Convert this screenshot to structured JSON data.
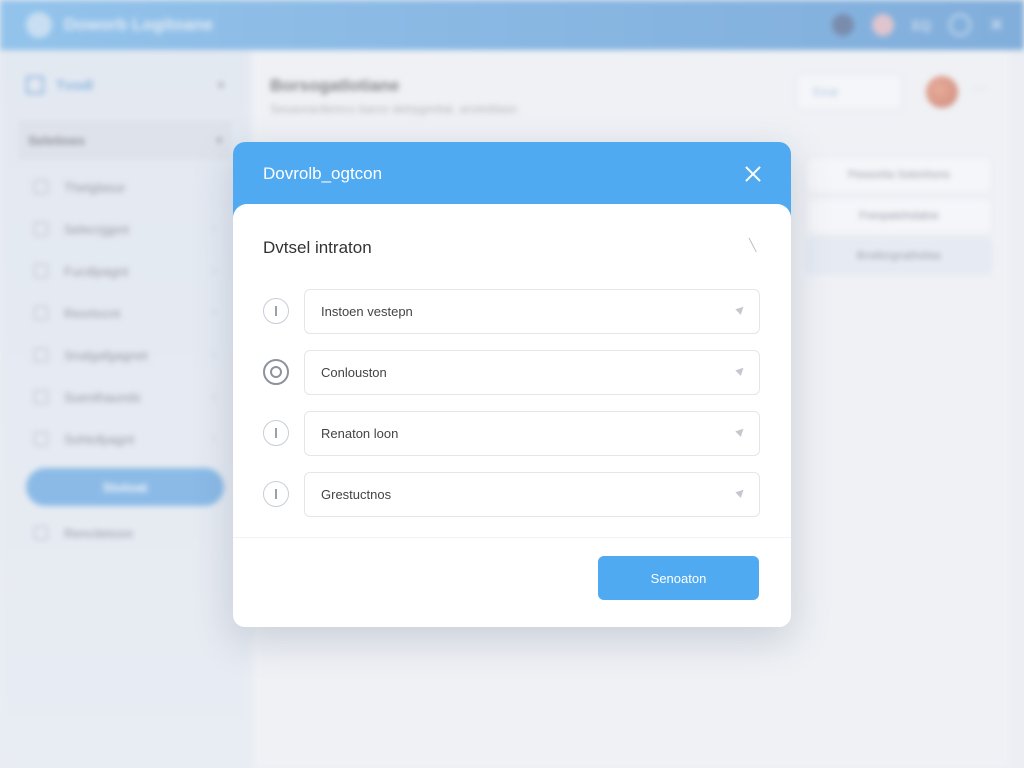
{
  "app": {
    "title": "Doworb Logitoane"
  },
  "topbar": {
    "lang": "EQ"
  },
  "sidebar": {
    "header": "Tvodl",
    "section": "Seletioes",
    "items": [
      {
        "label": "Thetglasur"
      },
      {
        "label": "Selecrjgpnt"
      },
      {
        "label": "Fucdipagnt"
      },
      {
        "label": "Reortocnt"
      },
      {
        "label": "Snalgafgagnet"
      },
      {
        "label": "Suenthaunds"
      },
      {
        "label": "Sohtofpagnt"
      }
    ],
    "active_item": "Stutoat",
    "footer_item": "Renctietoon"
  },
  "main": {
    "title": "Borsogatlotiane",
    "subtitle": "Sesaoractlemcs bacre detrpgretiat. anolotitasn",
    "search_label": "Eirat",
    "right_panel": [
      "Pessortia Sotonhons",
      "Frenpatohslatne",
      "Bnstlorgnatholias"
    ]
  },
  "dialog": {
    "title": "Dovrolb_ogtcon",
    "section_title": "Dvtsel intraton",
    "options": [
      {
        "label": "Instoen vestepn",
        "state": "indeterminate"
      },
      {
        "label": "Conlouston",
        "state": "selected"
      },
      {
        "label": "Renaton loon",
        "state": "indeterminate"
      },
      {
        "label": "Grestuctnos",
        "state": "indeterminate"
      }
    ],
    "primary_button": "Senoaton"
  }
}
